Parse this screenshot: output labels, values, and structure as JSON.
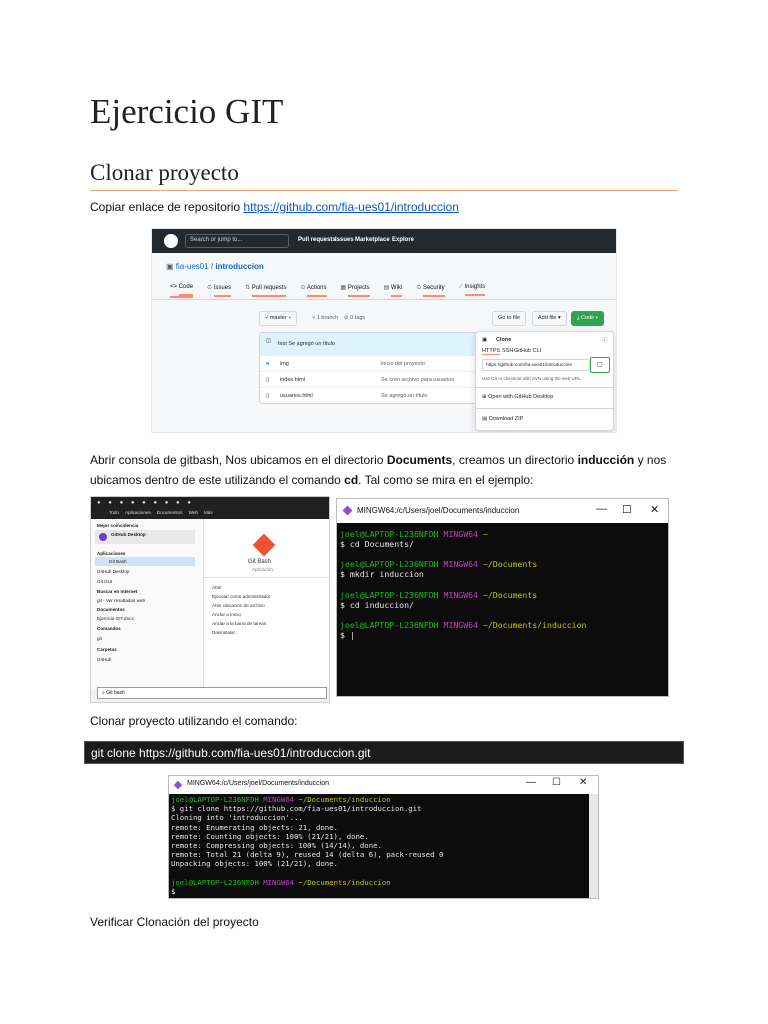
{
  "title": "Ejercicio GIT",
  "subtitle": "Clonar proyecto",
  "p1": {
    "text": "Copiar enlace de repositorio ",
    "link": "https://github.com/fia-ues01/introduccion"
  },
  "github": {
    "search": "Search or jump to...",
    "nav": [
      "Pull requests",
      "Issues",
      "Marketplace",
      "Explore"
    ],
    "repo_owner": "fia-ues01",
    "repo_name": "introduccion",
    "tabs": [
      "Code",
      "Issues",
      "Pull requests",
      "Actions",
      "Projects",
      "Wiki",
      "Security",
      "Insights"
    ],
    "branch": "master",
    "branch_count": "1 branch",
    "tags": "0 tags",
    "goto_file": "Go to file",
    "add_file": "Add file",
    "code_btn": "Code",
    "commit_msg": "test Se agregó un título",
    "files": [
      {
        "name": "img",
        "msg": "inicio del proyecto"
      },
      {
        "name": "index.html",
        "msg": "Se creó archivo para usuarios"
      },
      {
        "name": "usuarios.html",
        "msg": "Se agregó un título"
      }
    ],
    "clone_title": "Clone",
    "clone_tabs": [
      "HTTPS",
      "SSH",
      "GitHub CLI"
    ],
    "clone_url": "https://github.com/fia-ues01/introduccion",
    "clone_hint": "Use Git or checkout with SVN using the web URL.",
    "open_desktop": "Open with GitHub Desktop",
    "download_zip": "Download ZIP"
  },
  "p2": {
    "t1": "Abrir consola de gitbash, Nos ubicamos en el directorio ",
    "b1": "Documents",
    "t2": ", creamos un directorio ",
    "b2": "inducción",
    "t3": " y nos",
    "t4": "ubicamos dentro de este utilizando el comando ",
    "b3": "cd",
    "t5": ". Tal como se mira en el ejemplo:"
  },
  "winmenu": {
    "tabs": [
      "Todo",
      "Aplicaciones",
      "Documentos",
      "Web",
      "Más"
    ],
    "best_match": "Mejor coincidencia",
    "apps_head": "Aplicaciones",
    "items": [
      "GitHub Desktop",
      "Git GUI",
      "Git Bash"
    ],
    "app_name": "Git Bash",
    "app_sub": "Aplicación",
    "actions": [
      "Abrir",
      "Ejecutar como administrador",
      "Abrir ubicación de archivo",
      "Anclar a Inicio",
      "Anclar a la barra de tareas",
      "Desinstalar"
    ],
    "web_head": "Buscar en Internet",
    "web_item": "git - Ver resultados web",
    "docs_head": "Documentos",
    "docs_item": "Ejercicio GIT.docx",
    "cmd_head": "Comandos",
    "cmd_item": "git",
    "folders_head": "Carpetas",
    "folders_item": "GitHub",
    "search_value": "Git bash"
  },
  "term1": {
    "title": "MINGW64:/c/Users/joel/Documents/induccion",
    "lines": [
      {
        "type": "prompt",
        "user": "joel@LAPTOP-L236NFDH",
        "env": "MINGW64",
        "path": "~"
      },
      {
        "type": "cmd",
        "text": "$ cd Documents/"
      },
      {
        "type": "blank"
      },
      {
        "type": "prompt",
        "user": "joel@LAPTOP-L236NFDH",
        "env": "MINGW64",
        "path": "~/Documents"
      },
      {
        "type": "cmd",
        "text": "$ mkdir induccion"
      },
      {
        "type": "blank"
      },
      {
        "type": "prompt",
        "user": "joel@LAPTOP-L236NFDH",
        "env": "MINGW64",
        "path": "~/Documents"
      },
      {
        "type": "cmd",
        "text": "$ cd induccion/"
      },
      {
        "type": "blank"
      },
      {
        "type": "prompt",
        "user": "joel@LAPTOP-L236NFDH",
        "env": "MINGW64",
        "path": "~/Documents/induccion"
      },
      {
        "type": "cmd",
        "text": "$ |"
      }
    ]
  },
  "p3": "Clonar proyecto utilizando el comando:",
  "cmd": "git clone https://github.com/fia-ues01/introduccion.git",
  "term2": {
    "title": "MINGW64:/c/Users/joel/Documents/induccion",
    "lines": [
      {
        "type": "prompt",
        "user": "joel@LAPTOP-L236NFDH",
        "env": "MINGW64",
        "path": "~/Documents/induccion"
      },
      {
        "type": "cmd",
        "text": "$ git clone https://github.com/fia-ues01/introduccion.git"
      },
      {
        "type": "cmd",
        "text": "Cloning into 'introduccion'..."
      },
      {
        "type": "cmd",
        "text": "remote: Enumerating objects: 21, done."
      },
      {
        "type": "cmd",
        "text": "remote: Counting objects: 100% (21/21), done."
      },
      {
        "type": "cmd",
        "text": "remote: Compressing objects: 100% (14/14), done."
      },
      {
        "type": "cmd",
        "text": "remote: Total 21 (delta 9), reused 14 (delta 6), pack-reused 0"
      },
      {
        "type": "cmd",
        "text": "Unpacking objects: 100% (21/21), done."
      },
      {
        "type": "blank"
      },
      {
        "type": "prompt",
        "user": "joel@LAPTOP-L236NFDH",
        "env": "MINGW64",
        "path": "~/Documents/induccion"
      },
      {
        "type": "cmd",
        "text": "$"
      }
    ]
  },
  "p4": "Verificar Clonación del proyecto",
  "window_controls": {
    "min": "—",
    "max": "☐",
    "close": "✕"
  }
}
